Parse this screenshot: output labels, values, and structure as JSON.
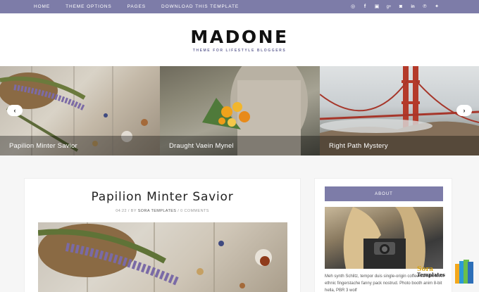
{
  "nav": {
    "items": [
      "HOME",
      "THEME OPTIONS",
      "PAGES",
      "DOWNLOAD THIS TEMPLATE"
    ]
  },
  "social": [
    "dribbble-icon",
    "facebook-icon",
    "flickr-icon",
    "google-plus-icon",
    "instagram-icon",
    "linkedin-icon",
    "pinterest-icon",
    "twitter-icon"
  ],
  "header": {
    "logo": "MADONE",
    "tagline": "THEME FOR LIFESTYLE BLOGGERS"
  },
  "slider": {
    "slides": [
      {
        "caption": "Papilion Minter Savior"
      },
      {
        "caption": "Draught Vaein Mynel"
      },
      {
        "caption": "Right Path Mystery"
      }
    ],
    "prev_icon": "‹",
    "next_icon": "›"
  },
  "post": {
    "title": "Papilion Minter Savior",
    "date": "04:22",
    "author_prefix": "/ BY",
    "author": "SORA TEMPLATES",
    "comments": "/ 0 COMMENTS"
  },
  "sidebar": {
    "about_title": "ABOUT",
    "about_text": "Meh synth Schlitz, tempor duis single-origin coffee ea next level ethnic fingerstache fanny pack nostrud. Photo booth anim 8-bit hella, PBR 3 wolf"
  },
  "watermark": {
    "line1": "Sora",
    "line2": "Templates"
  },
  "colors": {
    "accent": "#7d7ca8"
  }
}
